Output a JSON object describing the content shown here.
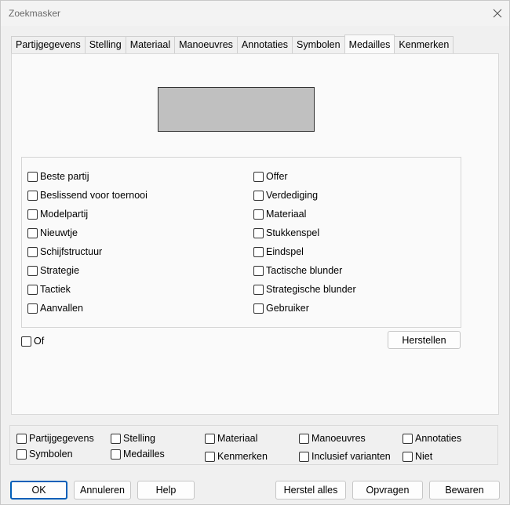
{
  "window": {
    "title": "Zoekmasker"
  },
  "tabs": [
    {
      "label": "Partijgegevens"
    },
    {
      "label": "Stelling"
    },
    {
      "label": "Materiaal"
    },
    {
      "label": "Manoeuvres"
    },
    {
      "label": "Annotaties"
    },
    {
      "label": "Symbolen"
    },
    {
      "label": "Medailles",
      "active": true
    },
    {
      "label": "Kenmerken"
    }
  ],
  "medals": {
    "left": [
      {
        "label": "Beste partij",
        "checked": false
      },
      {
        "label": "Beslissend voor toernooi",
        "checked": false
      },
      {
        "label": "Modelpartij",
        "checked": false
      },
      {
        "label": "Nieuwtje",
        "checked": false
      },
      {
        "label": "Schijfstructuur",
        "checked": false
      },
      {
        "label": "Strategie",
        "checked": false
      },
      {
        "label": "Tactiek",
        "checked": false
      },
      {
        "label": "Aanvallen",
        "checked": false
      }
    ],
    "right": [
      {
        "label": "Offer",
        "checked": false
      },
      {
        "label": "Verdediging",
        "checked": false
      },
      {
        "label": "Materiaal",
        "checked": false
      },
      {
        "label": "Stukkenspel",
        "checked": false
      },
      {
        "label": "Eindspel",
        "checked": false
      },
      {
        "label": "Tactische blunder",
        "checked": false
      },
      {
        "label": "Strategische blunder",
        "checked": false
      },
      {
        "label": "Gebruiker",
        "checked": false
      }
    ],
    "or_label": "Of",
    "reset_label": "Herstellen"
  },
  "filters": [
    {
      "label": "Partijgegevens",
      "checked": false
    },
    {
      "label": "Stelling",
      "checked": false
    },
    {
      "label": "Materiaal",
      "checked": false
    },
    {
      "label": "Manoeuvres",
      "checked": false
    },
    {
      "label": "Annotaties",
      "checked": false
    },
    {
      "label": "Symbolen",
      "checked": false
    },
    {
      "label": "Medailles",
      "checked": false
    },
    {
      "label": "Kenmerken",
      "checked": false
    },
    {
      "label": "Inclusief varianten",
      "checked": false
    },
    {
      "label": "Niet",
      "checked": false
    }
  ],
  "buttons": {
    "ok": "OK",
    "cancel": "Annuleren",
    "help": "Help",
    "reset_all": "Herstel alles",
    "query": "Opvragen",
    "save": "Bewaren"
  }
}
